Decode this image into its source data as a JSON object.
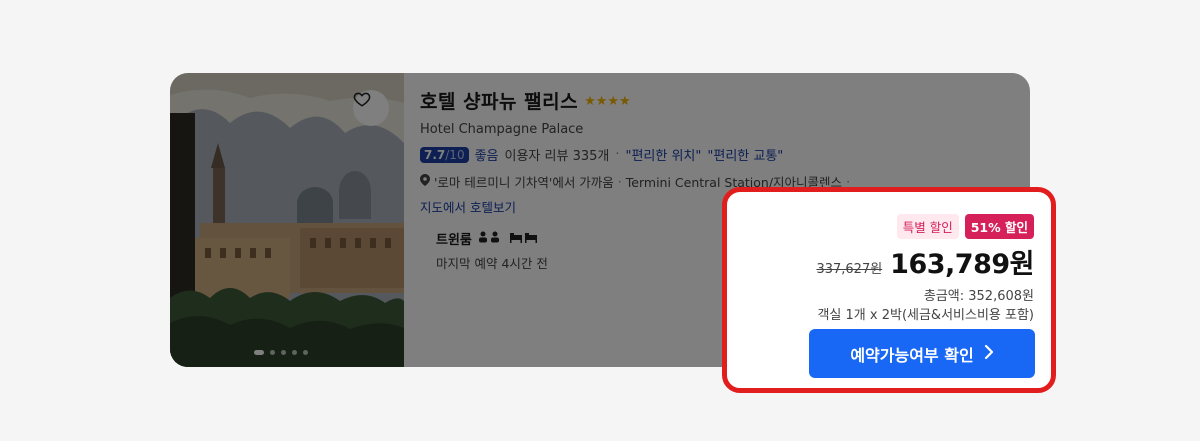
{
  "hotel": {
    "name_ko": "호텔 샹파뉴 팰리스",
    "stars": "★★★★",
    "name_en": "Hotel Champagne Palace",
    "score": "7.7",
    "score_max": "/10",
    "rating_word": "좋음",
    "review_count": "이용자 리뷰 335개",
    "separator": "·",
    "highlight_1": "\"편리한 위치\"",
    "highlight_2": "\"편리한 교통\"",
    "location": "'로마 테르미니 기차역'에서 가까움",
    "location_2": "Termini Central Station/지아니콜렌스",
    "map_link": "지도에서 호텔보기"
  },
  "room": {
    "type": "트윈룸",
    "note": "마지막 예약 4시간 전"
  },
  "price": {
    "badge_special": "특별 할인",
    "badge_discount": "51% 할인",
    "original": "337,627원",
    "sale": "163,789원",
    "total": "총금액: 352,608원",
    "nights": "객실 1개 x 2박(세금&서비스비용 포함)",
    "cta_label": "예약가능여부 확인"
  },
  "colors": {
    "brand_blue": "#1868f5",
    "score_blue": "#1a3fa6",
    "discount_pink": "#d6205a",
    "highlight_red": "#e11d1d",
    "star_gold": "#f4b400"
  }
}
